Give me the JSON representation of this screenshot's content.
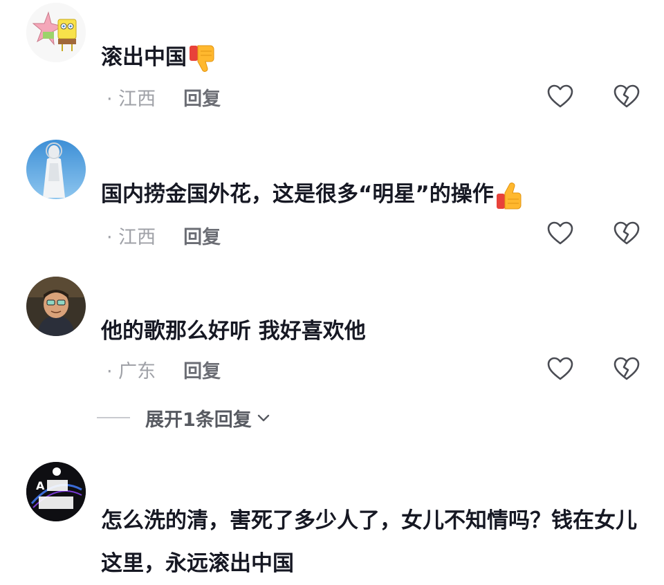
{
  "comments": [
    {
      "text": "滚出中国",
      "emoji": "thumbs-down-icon",
      "date": "",
      "region": "江西",
      "reply_label": "回复"
    },
    {
      "text": "国内捞金国外花，这是很多“明星”的操作",
      "emoji": "thumbs-up-icon",
      "date": "",
      "region": "江西",
      "reply_label": "回复"
    },
    {
      "text": "他的歌那么好听 我好喜欢他",
      "date": "",
      "region": "广东",
      "reply_label": "回复"
    },
    {
      "text": "怎么洗的清，害死了多少人了，女儿不知情吗？钱在女儿这里，永远滚出中国"
    }
  ],
  "expand_replies": {
    "label": "展开1条回复"
  },
  "colors": {
    "text": "#161823",
    "meta": "#9fa1a7",
    "reply": "#6b6d74",
    "icon_stroke": "#4a4c53"
  }
}
